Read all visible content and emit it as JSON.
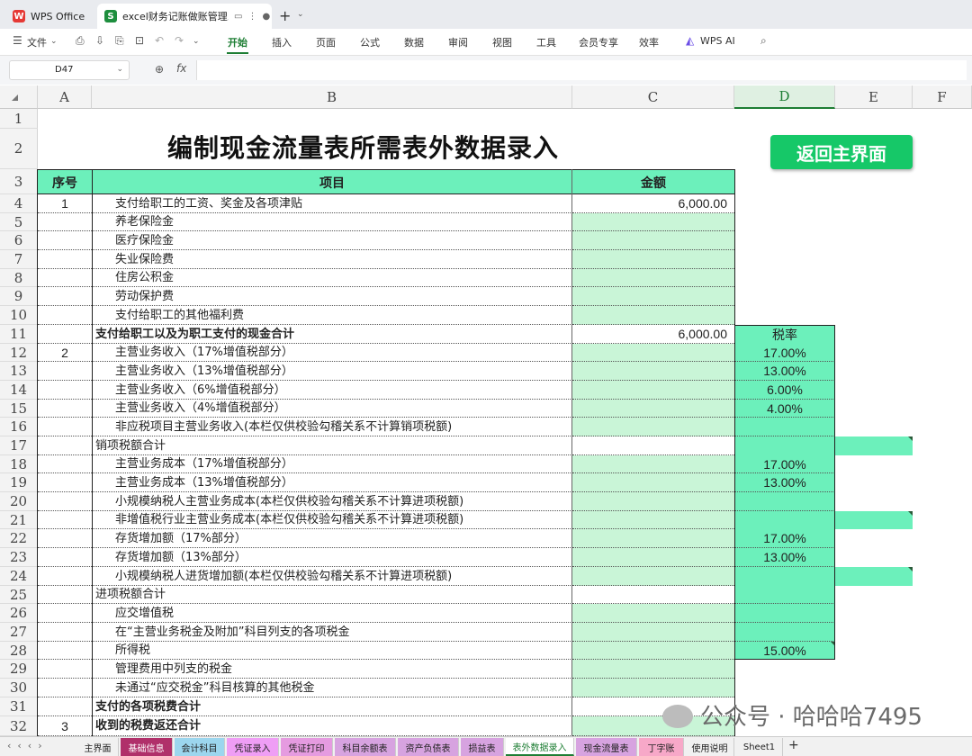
{
  "titlebar": {
    "app_tab": "WPS Office",
    "doc_tab": "excel财务记账做账管理系统",
    "doc_tab_icon": "S"
  },
  "ribbon": {
    "file": "文件",
    "tabs": [
      "开始",
      "插入",
      "页面",
      "公式",
      "数据",
      "审阅",
      "视图",
      "工具",
      "会员专享",
      "效率",
      "WPS AI"
    ],
    "active": "开始"
  },
  "formula_bar": {
    "cell_ref": "D47",
    "fx": "fx",
    "content": ""
  },
  "columns": [
    "A",
    "B",
    "C",
    "D",
    "E",
    "F"
  ],
  "rows": [
    "1",
    "2",
    "3",
    "4",
    "5",
    "6",
    "7",
    "8",
    "9",
    "10",
    "11",
    "12",
    "13",
    "14",
    "15",
    "16",
    "17",
    "18",
    "19",
    "20",
    "21",
    "22",
    "23",
    "24",
    "25",
    "26",
    "27",
    "28",
    "29",
    "30",
    "31",
    "32"
  ],
  "sheet": {
    "title": "编制现金流量表所需表外数据录入",
    "back_button": "返回主界面",
    "headers": {
      "seq": "序号",
      "item": "项目",
      "amount": "金额",
      "rate": "税率"
    },
    "rows": [
      {
        "seq": "1",
        "item": "支付给职工的工资、奖金及各项津贴",
        "amount": "6,000.00",
        "rate": ""
      },
      {
        "seq": "",
        "item": "养老保险金",
        "amount": "",
        "rate": ""
      },
      {
        "seq": "",
        "item": "医疗保险金",
        "amount": "",
        "rate": ""
      },
      {
        "seq": "",
        "item": "失业保险费",
        "amount": "",
        "rate": ""
      },
      {
        "seq": "",
        "item": "住房公积金",
        "amount": "",
        "rate": ""
      },
      {
        "seq": "",
        "item": "劳动保护费",
        "amount": "",
        "rate": ""
      },
      {
        "seq": "",
        "item": "支付给职工的其他福利费",
        "amount": "",
        "rate": ""
      },
      {
        "seq": "",
        "item": "支付给职工以及为职工支付的现金合计",
        "amount": "6,000.00",
        "rate": "税率"
      },
      {
        "seq": "2",
        "item": "主营业务收入（17%增值税部分）",
        "amount": "",
        "rate": "17.00%"
      },
      {
        "seq": "",
        "item": "主营业务收入（13%增值税部分）",
        "amount": "",
        "rate": "13.00%"
      },
      {
        "seq": "",
        "item": "主营业务收入（6%增值税部分）",
        "amount": "",
        "rate": "6.00%"
      },
      {
        "seq": "",
        "item": "主营业务收入（4%增值税部分）",
        "amount": "",
        "rate": "4.00%"
      },
      {
        "seq": "",
        "item": "非应税项目主营业务收入(本栏仅供校验勾稽关系不计算销项税额)",
        "amount": "",
        "rate": ""
      },
      {
        "seq": "",
        "item": "销项税额合计",
        "amount": "",
        "rate": ""
      },
      {
        "seq": "",
        "item": "主营业务成本（17%增值税部分）",
        "amount": "",
        "rate": "17.00%"
      },
      {
        "seq": "",
        "item": "主营业务成本（13%增值税部分）",
        "amount": "",
        "rate": "13.00%"
      },
      {
        "seq": "",
        "item": "小规模纳税人主营业务成本(本栏仅供校验勾稽关系不计算进项税额)",
        "amount": "",
        "rate": ""
      },
      {
        "seq": "",
        "item": "非增值税行业主营业务成本(本栏仅供校验勾稽关系不计算进项税额)",
        "amount": "",
        "rate": ""
      },
      {
        "seq": "",
        "item": "存货增加额（17%部分）",
        "amount": "",
        "rate": "17.00%"
      },
      {
        "seq": "",
        "item": "存货增加额（13%部分）",
        "amount": "",
        "rate": "13.00%"
      },
      {
        "seq": "",
        "item": "小规模纳税人进货增加额(本栏仅供校验勾稽关系不计算进项税额)",
        "amount": "",
        "rate": ""
      },
      {
        "seq": "",
        "item": "进项税额合计",
        "amount": "",
        "rate": ""
      },
      {
        "seq": "",
        "item": "应交增值税",
        "amount": "",
        "rate": ""
      },
      {
        "seq": "",
        "item": "在“主营业务税金及附加”科目列支的各项税金",
        "amount": "",
        "rate": ""
      },
      {
        "seq": "",
        "item": "所得税",
        "amount": "",
        "rate": "15.00%"
      },
      {
        "seq": "",
        "item": "管理费用中列支的税金",
        "amount": "",
        "rate": ""
      },
      {
        "seq": "",
        "item": "未通过“应交税金”科目核算的其他税金",
        "amount": "",
        "rate": ""
      },
      {
        "seq": "",
        "item": "支付的各项税费合计",
        "amount": "",
        "rate": ""
      },
      {
        "seq": "3",
        "item": "收到的税费返还合计",
        "amount": "",
        "rate": ""
      }
    ]
  },
  "sheet_tabs": [
    "主界面",
    "基础信息",
    "会计科目",
    "凭证录入",
    "凭证打印",
    "科目余额表",
    "资产负债表",
    "损益表",
    "表外数据录入",
    "现金流量表",
    "丁字账",
    "使用说明",
    "Sheet1"
  ],
  "active_sheet": "表外数据录入",
  "watermark": "公众号 · 哈哈哈7495"
}
